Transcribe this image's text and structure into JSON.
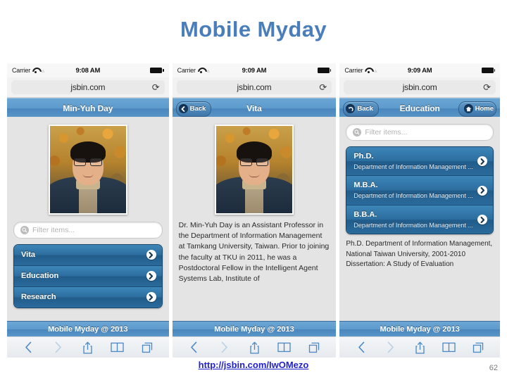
{
  "slide": {
    "title": "Mobile Myday",
    "source_link": "http://jsbin.com/IwOMezo",
    "page_number": "62"
  },
  "colors": {
    "title": "#4a7ebb",
    "header_blue": "#5d9ccd",
    "list_blue": "#2c6d9e",
    "link": "#1f1fcd"
  },
  "phones": [
    {
      "status": {
        "carrier": "Carrier",
        "time": "9:08 AM",
        "wifi_icon": "wifi-icon",
        "battery_icon": "battery-icon"
      },
      "browser": {
        "url": "jsbin.com",
        "reload_icon": "reload-icon"
      },
      "header": {
        "title": "Min-Yuh Day",
        "back_label": null,
        "home_label": null
      },
      "photo_alt": "portrait-photo",
      "filter": {
        "placeholder": "Filter items...",
        "search_icon": "search-icon"
      },
      "list": [
        {
          "title": "Vita",
          "subtitle": null
        },
        {
          "title": "Education",
          "subtitle": null
        },
        {
          "title": "Research",
          "subtitle": null
        }
      ],
      "paragraph": null,
      "footer": "Mobile Myday @ 2013",
      "toolbar": [
        "back-icon",
        "forward-icon",
        "share-icon",
        "bookmarks-icon",
        "tabs-icon"
      ]
    },
    {
      "status": {
        "carrier": "Carrier",
        "time": "9:09 AM",
        "wifi_icon": "wifi-icon",
        "battery_icon": "battery-icon"
      },
      "browser": {
        "url": "jsbin.com",
        "reload_icon": "reload-icon"
      },
      "header": {
        "title": "Vita",
        "back_label": "Back",
        "home_label": null
      },
      "photo_alt": "portrait-photo",
      "filter": null,
      "list": [],
      "paragraph": "Dr. Min-Yuh Day is an Assistant Professor in the Department of Information Management at Tamkang University, Taiwan. Prior to joining the faculty at TKU in 2011, he was a Postdoctoral Fellow in the Intelligent Agent Systems Lab, Institute of",
      "footer": "Mobile Myday @ 2013",
      "toolbar": [
        "back-icon",
        "forward-icon",
        "share-icon",
        "bookmarks-icon",
        "tabs-icon"
      ]
    },
    {
      "status": {
        "carrier": "Carrier",
        "time": "9:09 AM",
        "wifi_icon": "wifi-icon",
        "battery_icon": "battery-icon"
      },
      "browser": {
        "url": "jsbin.com",
        "reload_icon": "reload-icon"
      },
      "header": {
        "title": "Education",
        "back_label": "Back",
        "home_label": "Home"
      },
      "photo_alt": null,
      "filter": {
        "placeholder": "Filter items...",
        "search_icon": "search-icon"
      },
      "list": [
        {
          "title": "Ph.D.",
          "subtitle": "Department of Information Management ..."
        },
        {
          "title": "M.B.A.",
          "subtitle": "Department of Information Management ..."
        },
        {
          "title": "B.B.A.",
          "subtitle": "Department of Information Management ..."
        }
      ],
      "paragraph": "Ph.D. Department of Information Management, National Taiwan University, 2001-2010 Dissertation: A Study of Evaluation",
      "footer": "Mobile Myday @ 2013",
      "toolbar": [
        "back-icon",
        "forward-icon",
        "share-icon",
        "bookmarks-icon",
        "tabs-icon"
      ]
    }
  ]
}
